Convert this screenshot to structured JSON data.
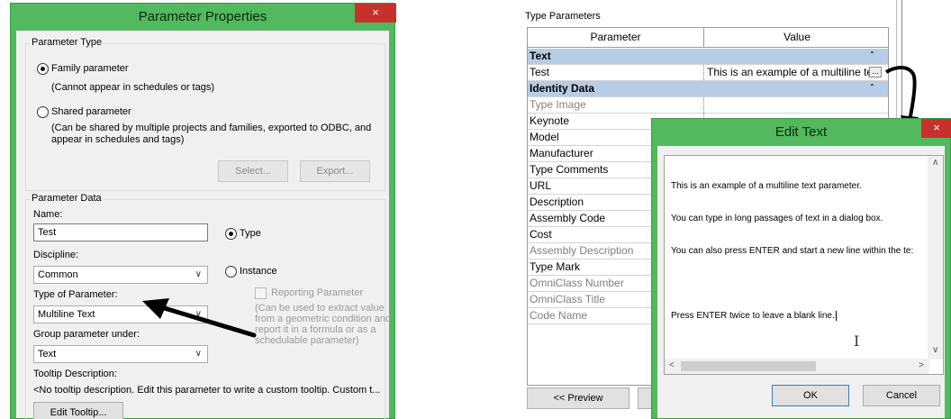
{
  "parameter_properties": {
    "title": "Parameter Properties",
    "close_glyph": "×",
    "parameter_type": {
      "legend": "Parameter Type",
      "family_label": "Family parameter",
      "family_note": "(Cannot appear in schedules or tags)",
      "shared_label": "Shared parameter",
      "shared_note_1": "(Can be shared by multiple projects and families, exported to ODBC, and",
      "shared_note_2": "appear in schedules and tags)",
      "select_button": "Select...",
      "export_button": "Export...",
      "selected": "family"
    },
    "parameter_data": {
      "legend": "Parameter Data",
      "name_label": "Name:",
      "name_value": "Test",
      "type_radio_label": "Type",
      "instance_radio_label": "Instance",
      "selected": "type",
      "discipline_label": "Discipline:",
      "discipline_value": "Common",
      "type_of_parameter_label": "Type of Parameter:",
      "type_of_parameter_value": "Multiline Text",
      "reporting_label": "Reporting Parameter",
      "reporting_note_1": "(Can be used to extract value",
      "reporting_note_2": "from a geometric condition and",
      "reporting_note_3": "report it in a formula or as a",
      "reporting_note_4": "schedulable parameter)",
      "group_label": "Group parameter under:",
      "group_value": "Text",
      "tooltip_label": "Tooltip Description:",
      "tooltip_value": "<No tooltip description. Edit this parameter to write a custom tooltip. Custom t...",
      "edit_tooltip_button": "Edit Tooltip..."
    }
  },
  "type_parameters": {
    "title": "Type Parameters",
    "columns": [
      "Parameter",
      "Value"
    ],
    "rows": [
      {
        "kind": "group",
        "name": "Text",
        "caret": "ˆ"
      },
      {
        "kind": "param",
        "name": "Test",
        "value": "This is an example of a multiline te:",
        "button": "..."
      },
      {
        "kind": "group",
        "name": "Identity Data",
        "caret": "ˆ"
      },
      {
        "kind": "param",
        "name": "Type Image",
        "grey": true
      },
      {
        "kind": "param",
        "name": "Keynote"
      },
      {
        "kind": "param",
        "name": "Model"
      },
      {
        "kind": "param",
        "name": "Manufacturer"
      },
      {
        "kind": "param",
        "name": "Type Comments"
      },
      {
        "kind": "param",
        "name": "URL"
      },
      {
        "kind": "param",
        "name": "Description"
      },
      {
        "kind": "param",
        "name": "Assembly Code"
      },
      {
        "kind": "param",
        "name": "Cost"
      },
      {
        "kind": "param",
        "name": "Assembly Description",
        "grey": true
      },
      {
        "kind": "param",
        "name": "Type Mark"
      },
      {
        "kind": "param",
        "name": "OmniClass Number",
        "grey": true
      },
      {
        "kind": "param",
        "name": "OmniClass Title",
        "grey": true
      },
      {
        "kind": "param",
        "name": "Code Name",
        "grey": true
      }
    ],
    "preview_button": "<< Preview"
  },
  "edit_text": {
    "title": "Edit Text",
    "close_glyph": "×",
    "lines": [
      "This is an example of a multiline text parameter.",
      "You can type in long passages of text in a dialog box.",
      "You can also press ENTER and start a new line within the te:",
      "",
      "Press ENTER twice to leave a blank line."
    ],
    "ok_button": "OK",
    "cancel_button": "Cancel"
  },
  "colors": {
    "dialog_frame": "#52b95e",
    "close_button": "#c7312b",
    "group_row": "#b9cce6"
  }
}
